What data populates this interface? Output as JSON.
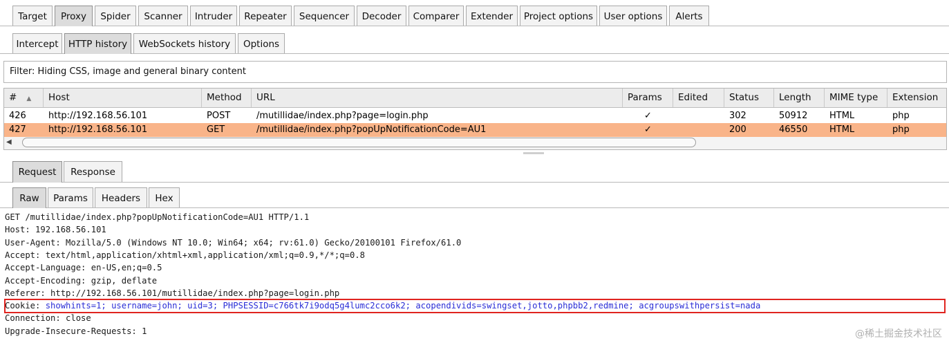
{
  "main_tabs": [
    "Target",
    "Proxy",
    "Spider",
    "Scanner",
    "Intruder",
    "Repeater",
    "Sequencer",
    "Decoder",
    "Comparer",
    "Extender",
    "Project options",
    "User options",
    "Alerts"
  ],
  "proxy_tabs": [
    "Intercept",
    "HTTP history",
    "WebSockets history",
    "Options"
  ],
  "filter_text": "Filter: Hiding CSS, image and general binary content",
  "table": {
    "columns": [
      "#",
      "Host",
      "Method",
      "URL",
      "Params",
      "Edited",
      "Status",
      "Length",
      "MIME type",
      "Extension"
    ],
    "rows": [
      {
        "num": "426",
        "host": "http://192.168.56.101",
        "method": "POST",
        "url": "/mutillidae/index.php?page=login.php",
        "params": "✓",
        "edited": "",
        "status": "302",
        "length": "50912",
        "mime": "HTML",
        "ext": "php",
        "selected": false
      },
      {
        "num": "427",
        "host": "http://192.168.56.101",
        "method": "GET",
        "url": "/mutillidae/index.php?popUpNotificationCode=AU1",
        "params": "✓",
        "edited": "",
        "status": "200",
        "length": "46550",
        "mime": "HTML",
        "ext": "php",
        "selected": true
      }
    ]
  },
  "message_tabs": [
    "Request",
    "Response"
  ],
  "view_tabs": [
    "Raw",
    "Params",
    "Headers",
    "Hex"
  ],
  "raw_lines": [
    "GET /mutillidae/index.php?popUpNotificationCode=AU1 HTTP/1.1",
    "Host: 192.168.56.101",
    "User-Agent: Mozilla/5.0 (Windows NT 10.0; Win64; x64; rv:61.0) Gecko/20100101 Firefox/61.0",
    "Accept: text/html,application/xhtml+xml,application/xml;q=0.9,*/*;q=0.8",
    "Accept-Language: en-US,en;q=0.5",
    "Accept-Encoding: gzip, deflate",
    "Referer: http://192.168.56.101/mutillidae/index.php?page=login.php"
  ],
  "cookie_key": "Cookie:",
  "cookie_value": " showhints=1; username=john; uid=3; PHPSESSID=c766tk7i9odq5g4lumc2cco6k2; acopendivids=swingset,jotto,phpbb2,redmine; acgroupswithpersist=nada",
  "raw_lines_after": [
    "Connection: close",
    "Upgrade-Insecure-Requests: 1"
  ],
  "watermark": "@稀土掘金技术社区",
  "colors": {
    "selected_row": "#f9b489",
    "highlight_box": "#e0241f"
  }
}
